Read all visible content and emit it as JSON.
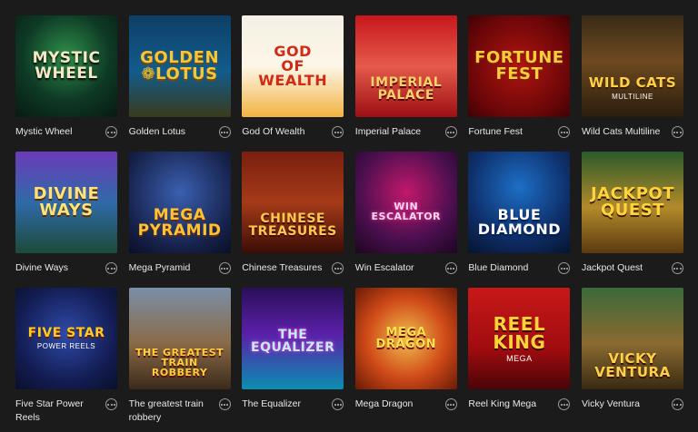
{
  "games": [
    {
      "title": "Mystic Wheel",
      "art": "MYSTIC\nWHEEL",
      "style": "t-mystic"
    },
    {
      "title": "Golden Lotus",
      "art": "GOLDEN\n❁LOTUS",
      "style": "t-golden"
    },
    {
      "title": "God Of Wealth",
      "art": "GOD\nOF\nWEALTH",
      "style": "t-god"
    },
    {
      "title": "Imperial Palace",
      "art": "IMPERIAL\nPALACE",
      "style": "t-imperial"
    },
    {
      "title": "Fortune Fest",
      "art": "FORTUNE\nFEST",
      "style": "t-fortune"
    },
    {
      "title": "Wild Cats Multiline",
      "art": "WILD CATS",
      "sub": "MULTILINE",
      "style": "t-wildcats"
    },
    {
      "title": "Divine Ways",
      "art": "DIVINE\nWAYS",
      "style": "t-divine"
    },
    {
      "title": "Mega Pyramid",
      "art": "MEGA\nPYRAMID",
      "style": "t-mega"
    },
    {
      "title": "Chinese Treasures",
      "art": "CHINESE\nTREASURES",
      "style": "t-chinese"
    },
    {
      "title": "Win Escalator",
      "art": "WIN\nESCALATOR",
      "style": "t-win"
    },
    {
      "title": "Blue Diamond",
      "art": "BLUE\nDIAMOND",
      "style": "t-blue"
    },
    {
      "title": "Jackpot Quest",
      "art": "JACKPOT\nQUEST",
      "style": "t-jackpot"
    },
    {
      "title": "Five Star Power Reels",
      "art": "FIVE STAR",
      "sub": "POWER REELS",
      "style": "t-fivestar"
    },
    {
      "title": "The greatest train robbery",
      "art": "THE GREATEST\nTRAIN ROBBERY",
      "style": "t-train"
    },
    {
      "title": "The Equalizer",
      "art": "THE\nEQUALIZER",
      "style": "t-equalizer"
    },
    {
      "title": "Mega Dragon",
      "art": "MEGA DRAGON",
      "style": "t-dragon"
    },
    {
      "title": "Reel King Mega",
      "art": "REEL\nKING",
      "sub": "MEGA",
      "style": "t-reel"
    },
    {
      "title": "Vicky Ventura",
      "art": "VICKY\nVENTURA",
      "style": "t-vicky"
    }
  ],
  "icons": {
    "info": "more-dots-icon"
  }
}
